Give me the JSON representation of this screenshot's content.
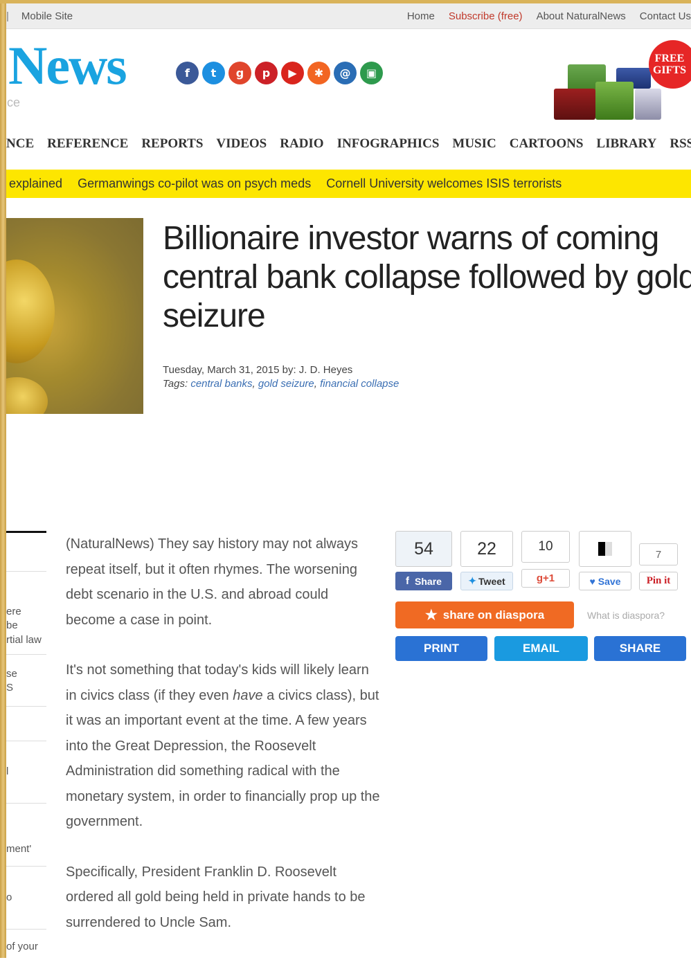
{
  "topbar": {
    "left_sep": "|",
    "mobile_site": "Mobile Site",
    "links": [
      "Home",
      "Subscribe (free)",
      "About NaturalNews",
      "Contact Us"
    ]
  },
  "header": {
    "logo": "News",
    "logo_sub": "ce",
    "social_icons": [
      {
        "name": "facebook-icon",
        "glyph": "f",
        "color": "#3b5998"
      },
      {
        "name": "twitter-icon",
        "glyph": "t",
        "color": "#1d8fe0"
      },
      {
        "name": "google-plus-icon",
        "glyph": "g",
        "color": "#e0452c"
      },
      {
        "name": "pinterest-icon",
        "glyph": "p",
        "color": "#cc2127"
      },
      {
        "name": "youtube-icon",
        "glyph": "▶",
        "color": "#d9251d"
      },
      {
        "name": "rss-icon",
        "glyph": "✱",
        "color": "#f26522"
      },
      {
        "name": "email-icon",
        "glyph": "@",
        "color": "#2a6db5"
      },
      {
        "name": "mobile-icon",
        "glyph": "▣",
        "color": "#2e9a4d"
      }
    ],
    "free_gifts": [
      "FREE",
      "GIFTS"
    ]
  },
  "nav": [
    "NCE",
    "REFERENCE",
    "REPORTS",
    "VIDEOS",
    "RADIO",
    "INFOGRAPHICS",
    "MUSIC",
    "CARTOONS",
    "LIBRARY",
    "RSS"
  ],
  "ticker": [
    "explained",
    "Germanwings co-pilot was on psych meds",
    "Cornell University welcomes ISIS terrorists"
  ],
  "article": {
    "headline_lines": [
      "Billionaire investor warns of coming",
      "central bank collapse followed by gold",
      "seizure"
    ],
    "date_by": "Tuesday, March 31, 2015 by: J. D. Heyes",
    "tags_label": "Tags:",
    "tags": [
      "central banks",
      "gold seizure",
      "financial collapse"
    ],
    "paragraphs": [
      "(NaturalNews) They say history may not always repeat itself, but it often rhymes. The worsening debt scenario in the U.S. and abroad could become a case in point.",
      "It's not something that today's kids will likely learn in civics class (if they even have a civics class), but it was an important event at the time. A few years into the Great Depression, the Roosevelt Administration did something radical with the monetary system, in order to financially prop up the government.",
      "Specifically, President Franklin D. Roosevelt ordered all gold being held in private hands to be surrendered to Uncle Sam."
    ]
  },
  "sidebar_fragments": [
    "ere",
    "be",
    "rtial law",
    "se",
    "S",
    "l",
    "ment'",
    "o",
    "of your"
  ],
  "share": {
    "facebook_count": "54",
    "facebook_label": "Share",
    "tweet_count": "22",
    "tweet_label": "Tweet",
    "gplus_count": "10",
    "gplus_label": "g+1",
    "delicious_label": "Save",
    "pinterest_count": "7",
    "pinterest_label": "Pin it",
    "diaspora_label": "share on diaspora",
    "what_is_diaspora": "What is diaspora?",
    "print": "PRINT",
    "email": "EMAIL",
    "share": "SHARE"
  }
}
